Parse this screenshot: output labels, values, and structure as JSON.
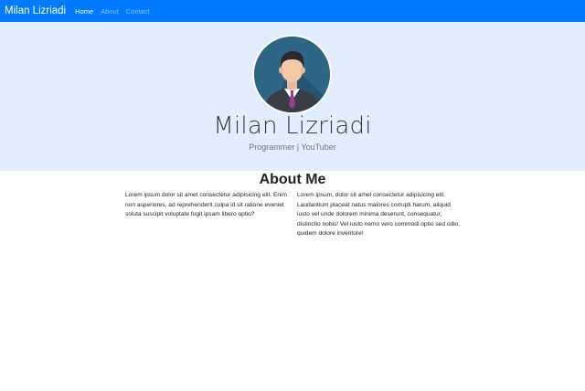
{
  "navbar": {
    "brand": "Milan Lizriadi",
    "links": [
      {
        "label": "Home",
        "active": true
      },
      {
        "label": "About",
        "active": false
      },
      {
        "label": "Contact",
        "active": false
      }
    ]
  },
  "hero": {
    "name": "Milan Lizriadi",
    "subtitle": "Programmer | YouTuber"
  },
  "about": {
    "title": "About Me",
    "left_text": "Lorem ipsum dolor sit amet consectetur adipisicing elit. Enim non asperiores, ad reprehenderit culpa id sit ratione eveniet soluta suscipit voluptate fugit ipsam libero optio?",
    "right_text": "Lorem ipsum, dolor sit amet consectetur adipisicing elit. Laudantium placeat natus maiores corrupti harum, aliquid iusto vel unde dolorem minima deserunt, consequatur, distinctio nobis! Vel iusto nemo vero commodi optio sed odio, quidem dolore inventore!"
  },
  "colors": {
    "navbar": "#007bff",
    "jumbotron": "#e2edfe",
    "avatar_bg": "#2b5d7a",
    "tie": "#9b3d8f"
  },
  "icons": {
    "avatar": "person-avatar-icon"
  }
}
